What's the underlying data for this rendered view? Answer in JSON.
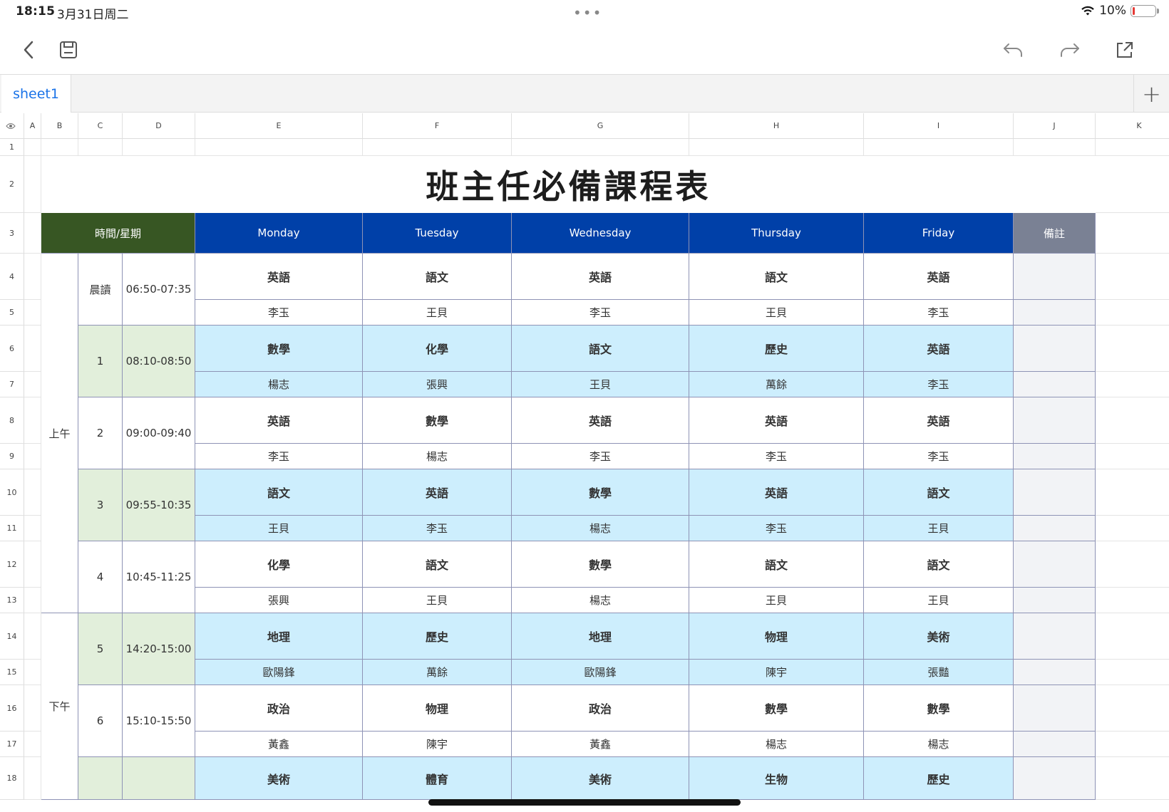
{
  "status_bar": {
    "time": "18:15",
    "date": "3月31日周二",
    "battery_text": "10%",
    "battery_level": 0.1
  },
  "sheet": {
    "active_tab": "sheet1",
    "add_tab": "+"
  },
  "column_headers": [
    "A",
    "B",
    "C",
    "D",
    "E",
    "F",
    "G",
    "H",
    "I",
    "J",
    "K"
  ],
  "row_headers": [
    "1",
    "2",
    "3",
    "4",
    "5",
    "6",
    "7",
    "8",
    "9",
    "10",
    "11",
    "12",
    "13",
    "14",
    "15",
    "16",
    "17",
    "18"
  ],
  "table": {
    "title": "班主任必備課程表",
    "header_time": "時間/星期",
    "days": [
      "Monday",
      "Tuesday",
      "Wednesday",
      "Thursday",
      "Friday"
    ],
    "note_header": "備註",
    "periods": [
      {
        "label": "晨讀",
        "time": "06:50-07:35",
        "subjects": [
          "英語",
          "語文",
          "英語",
          "語文",
          "英語"
        ],
        "teachers": [
          "李玉",
          "王貝",
          "李玉",
          "王貝",
          "李玉"
        ]
      },
      {
        "label": "1",
        "time": "08:10-08:50",
        "subjects": [
          "數學",
          "化學",
          "語文",
          "歷史",
          "英語"
        ],
        "teachers": [
          "楊志",
          "張興",
          "王貝",
          "萬餘",
          "李玉"
        ]
      },
      {
        "label": "2",
        "time": "09:00-09:40",
        "subjects": [
          "英語",
          "數學",
          "英語",
          "英語",
          "英語"
        ],
        "teachers": [
          "李玉",
          "楊志",
          "李玉",
          "李玉",
          "李玉"
        ]
      },
      {
        "label": "3",
        "time": "09:55-10:35",
        "subjects": [
          "語文",
          "英語",
          "數學",
          "英語",
          "語文"
        ],
        "teachers": [
          "王貝",
          "李玉",
          "楊志",
          "李玉",
          "王貝"
        ]
      },
      {
        "label": "4",
        "time": "10:45-11:25",
        "subjects": [
          "化學",
          "語文",
          "數學",
          "語文",
          "語文"
        ],
        "teachers": [
          "張興",
          "王貝",
          "楊志",
          "王貝",
          "王貝"
        ]
      },
      {
        "label": "5",
        "time": "14:20-15:00",
        "subjects": [
          "地理",
          "歷史",
          "地理",
          "物理",
          "美術"
        ],
        "teachers": [
          "歐陽鋒",
          "萬餘",
          "歐陽鋒",
          "陳宇",
          "張豔"
        ]
      },
      {
        "label": "6",
        "time": "15:10-15:50",
        "subjects": [
          "政治",
          "物理",
          "政治",
          "數學",
          "數學"
        ],
        "teachers": [
          "黃鑫",
          "陳宇",
          "黃鑫",
          "楊志",
          "楊志"
        ]
      },
      {
        "label": "",
        "time": "",
        "subjects": [
          "美術",
          "體育",
          "美術",
          "生物",
          "歷史"
        ],
        "teachers": []
      }
    ],
    "sessions": {
      "morning": "上午",
      "afternoon": "下午"
    }
  },
  "colors": {
    "header_green": "#375623",
    "header_blue": "#0040a8",
    "header_gray": "#7a8194",
    "row_blue": "#cdeefd",
    "row_green": "#e2efdb",
    "tab_active": "#1a73e8"
  }
}
